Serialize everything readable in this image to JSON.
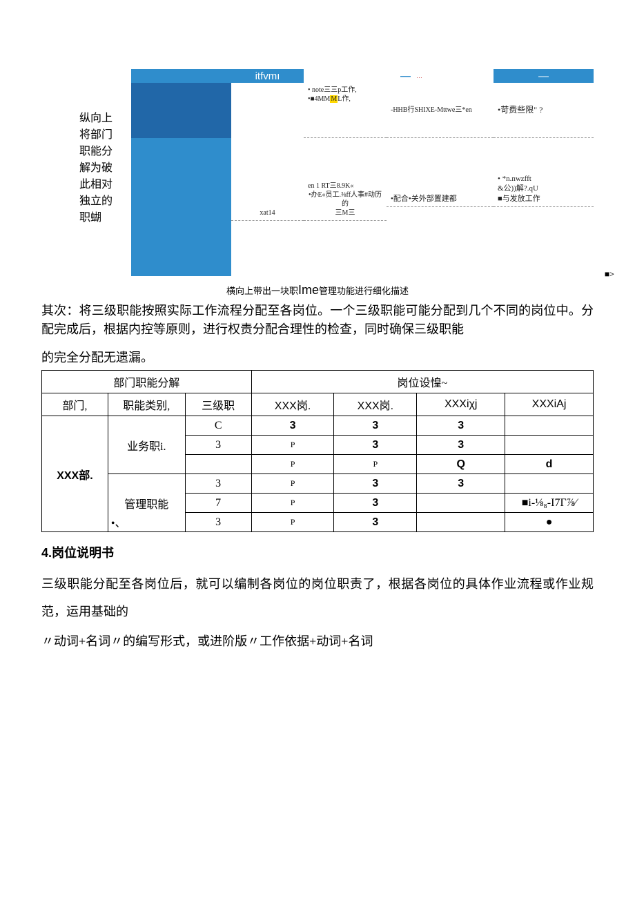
{
  "diagram": {
    "side_label": "纵向上将部门职能分解为破此相对独立的职蝴",
    "header_b": "itfvmı",
    "header_d_dash": "—",
    "header_d_dots": "…",
    "header_e_dash": "—",
    "cell_c1_l1": "• note三三p工作,",
    "cell_c1_l2_pre": "•■4MM",
    "cell_c1_l2_mark": "M",
    "cell_c1_l2_post": "L作,",
    "cell_d1": "-HHB行SHIXE-Mttwe三*en",
    "cell_e1": "•苛费些限\" ?",
    "cell_b2": "xat14",
    "cell_c2_l1": "en 1 RT三8.9K«",
    "cell_c2_l2": "•办E«员工.⅜ff人事#动历的",
    "cell_c2_l3": "三M三",
    "cell_d2": "•配合•关外部置建都",
    "cell_e2_l1": "• *n.nwzfft",
    "cell_e2_l2": "&公))解?.qU",
    "cell_e2_l3": "■与发放工作",
    "arrow": "■>"
  },
  "caption": {
    "pre": "横向上带出一块职",
    "mid": "Ime",
    "post": "管理功能进行细化描述"
  },
  "para1": "其次：将三级职能按照实际工作流程分配至各岗位。一个三级职能可能分配到几个不同的岗位中。分配完成后，根据内控等原则，进行权责分配合理性的检查，同时确保三级职能",
  "para2": "的完全分配无遗漏。",
  "table": {
    "group1": "部门职能分解",
    "group2": "岗位设惶~",
    "h_dept": "部门,",
    "h_cat": "职能类别,",
    "h_lvl3": "三级职",
    "h_p1": "XXX岗.",
    "h_p2": "XXX岗.",
    "h_p3": "XXXiχj",
    "h_p4": "XXXiAj",
    "dept": "XXX部.",
    "cat_biz": "业务职i.",
    "cat_mgmt_a": "管理职能",
    "cat_mgmt_b": "•、",
    "r1": {
      "c": "C",
      "p1": "3",
      "p2": "3",
      "p3": "3",
      "p4": ""
    },
    "r2": {
      "c": "3",
      "p1": "P",
      "p2": "3",
      "p3": "3",
      "p4": ""
    },
    "r3": {
      "c": "",
      "p1": "P",
      "p2": "P",
      "p3": "Q",
      "p4": "d"
    },
    "r4": {
      "c": "3",
      "p1": "P",
      "p2": "3",
      "p3": "3",
      "p4": ""
    },
    "r5": {
      "c": "7",
      "p1": "P",
      "p2": "3",
      "p3": "",
      "p4": "■i-⅛₈-I7Γ⅞⁄"
    },
    "r6": {
      "c": "3",
      "p1": "P",
      "p2": "3",
      "p3": "",
      "p4": "●"
    }
  },
  "section4_title": "4.岗位说明书",
  "para3": "三级职能分配至各岗位后，就可以编制各岗位的岗位职责了，根据各岗位的具体作业流程或作业规范，运用基础的",
  "para4": "〃动词+名词〃的编写形式，或进阶版〃工作依据+动词+名词"
}
